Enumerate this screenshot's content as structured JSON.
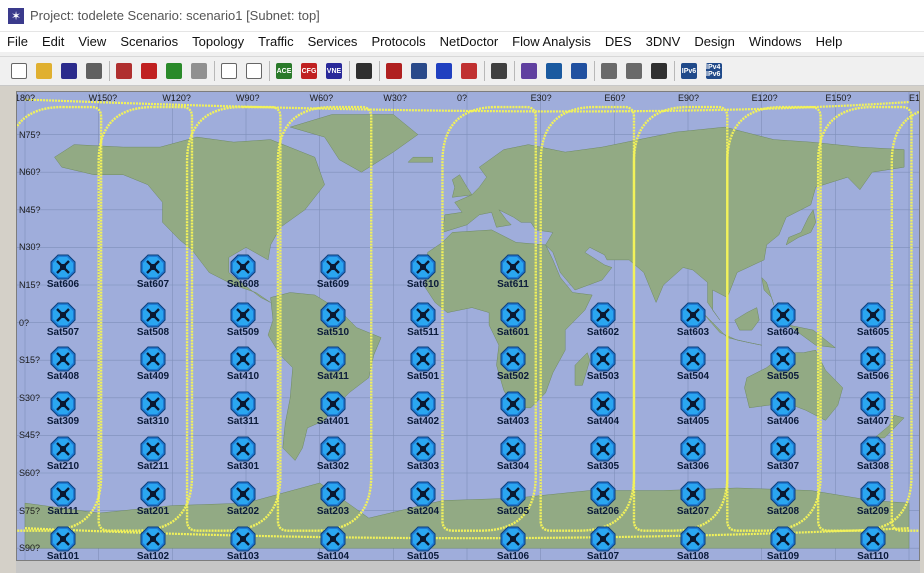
{
  "window": {
    "title": "Project: todelete Scenario: scenario1  [Subnet: top]"
  },
  "menu": [
    "File",
    "Edit",
    "View",
    "Scenarios",
    "Topology",
    "Traffic",
    "Services",
    "Protocols",
    "NetDoctor",
    "Flow Analysis",
    "DES",
    "3DNV",
    "Design",
    "Windows",
    "Help"
  ],
  "toolbar": {
    "buttons": [
      {
        "name": "new-icon",
        "color": "#ffffff",
        "text": ""
      },
      {
        "name": "open-folder-icon",
        "color": "#e0b030",
        "text": ""
      },
      {
        "name": "save-icon",
        "color": "#2b2b8c",
        "text": ""
      },
      {
        "name": "print-icon",
        "color": "#606060",
        "text": ""
      },
      {
        "name": "object-palette-icon",
        "color": "#b03030",
        "text": ""
      },
      {
        "name": "fail-node-icon",
        "color": "#c02020",
        "text": ""
      },
      {
        "name": "recover-node-icon",
        "color": "#2a8a2a",
        "text": ""
      },
      {
        "name": "location-pin-icon",
        "color": "#909090",
        "text": ""
      },
      {
        "name": "zoom-in-icon",
        "color": "#ffffff",
        "text": ""
      },
      {
        "name": "zoom-out-icon",
        "color": "#ffffff",
        "text": ""
      },
      {
        "name": "ace-icon",
        "color": "#2a7a2a",
        "text": "ACE"
      },
      {
        "name": "cfg-icon",
        "color": "#c02020",
        "text": "CFG"
      },
      {
        "name": "vne-icon",
        "color": "#2a2a9a",
        "text": "VNE"
      },
      {
        "name": "traffic-light-icon",
        "color": "#303030",
        "text": ""
      },
      {
        "name": "configure-run-icon",
        "color": "#b02020",
        "text": ""
      },
      {
        "name": "view-results-icon",
        "color": "#2a4a8a",
        "text": ""
      },
      {
        "name": "link-topology-icon",
        "color": "#2040c0",
        "text": ""
      },
      {
        "name": "failure-impact-icon",
        "color": "#c03030",
        "text": ""
      },
      {
        "name": "hide-graphs-icon",
        "color": "#404040",
        "text": ""
      },
      {
        "name": "network-icon",
        "color": "#6040a0",
        "text": ""
      },
      {
        "name": "routing-icon",
        "color": "#1a5aa0",
        "text": ""
      },
      {
        "name": "device-icon",
        "color": "#2050a0",
        "text": ""
      },
      {
        "name": "reports-icon",
        "color": "#6a6a6a",
        "text": ""
      },
      {
        "name": "graph-icon",
        "color": "#6a6a6a",
        "text": ""
      },
      {
        "name": "info-icon",
        "color": "#303030",
        "text": ""
      },
      {
        "name": "ipv6-icon",
        "color": "#204a8a",
        "text": "IPv6"
      },
      {
        "name": "ipv4-ipv6-icon",
        "color": "#204a8a",
        "text": "IPv4 IPv6"
      }
    ]
  },
  "map": {
    "longitude_labels": [
      {
        "text": "180?",
        "value": -180
      },
      {
        "text": "W150?",
        "value": -150
      },
      {
        "text": "W120?",
        "value": -120
      },
      {
        "text": "W90?",
        "value": -90
      },
      {
        "text": "W60?",
        "value": -60
      },
      {
        "text": "W30?",
        "value": -30
      },
      {
        "text": "0?",
        "value": 0
      },
      {
        "text": "E30?",
        "value": 30
      },
      {
        "text": "E60?",
        "value": 60
      },
      {
        "text": "E90?",
        "value": 90
      },
      {
        "text": "E120?",
        "value": 120
      },
      {
        "text": "E150?",
        "value": 150
      },
      {
        "text": "E1",
        "value": 180
      }
    ],
    "latitude_labels": [
      {
        "text": "N75?",
        "value": 75
      },
      {
        "text": "N60?",
        "value": 60
      },
      {
        "text": "N45?",
        "value": 45
      },
      {
        "text": "N30?",
        "value": 30
      },
      {
        "text": "N15?",
        "value": 15
      },
      {
        "text": "0?",
        "value": 0
      },
      {
        "text": "S15?",
        "value": -15
      },
      {
        "text": "S30?",
        "value": -30
      },
      {
        "text": "S45?",
        "value": -45
      },
      {
        "text": "S60?",
        "value": -60
      },
      {
        "text": "S75?",
        "value": -75
      },
      {
        "text": "S90?",
        "value": -90
      }
    ],
    "colors": {
      "ocean": "#9faddb",
      "land": "#92aa84",
      "orbit": "#f2f25a",
      "grid": "#7f8fba"
    },
    "satellites": [
      [
        "Sat606",
        "Sat607",
        "Sat608",
        "Sat609",
        "Sat610",
        "Sat611",
        "",
        "",
        "",
        ""
      ],
      [
        "Sat507",
        "Sat508",
        "Sat509",
        "Sat510",
        "Sat511",
        "Sat601",
        "Sat602",
        "Sat603",
        "Sat604",
        "Sat605"
      ],
      [
        "Sat408",
        "Sat409",
        "Sat410",
        "Sat411",
        "Sat501",
        "Sat502",
        "Sat503",
        "Sat504",
        "Sat505",
        "Sat506"
      ],
      [
        "Sat309",
        "Sat310",
        "Sat311",
        "Sat401",
        "Sat402",
        "Sat403",
        "Sat404",
        "Sat405",
        "Sat406",
        "Sat407"
      ],
      [
        "Sat210",
        "Sat211",
        "Sat301",
        "Sat302",
        "Sat303",
        "Sat304",
        "Sat305",
        "Sat306",
        "Sat307",
        "Sat308"
      ],
      [
        "Sat111",
        "Sat201",
        "Sat202",
        "Sat203",
        "Sat204",
        "Sat205",
        "Sat206",
        "Sat207",
        "Sat208",
        "Sat209"
      ],
      [
        "Sat101",
        "Sat102",
        "Sat103",
        "Sat104",
        "Sat105",
        "Sat106",
        "Sat107",
        "Sat108",
        "Sat109",
        "Sat110"
      ]
    ]
  }
}
